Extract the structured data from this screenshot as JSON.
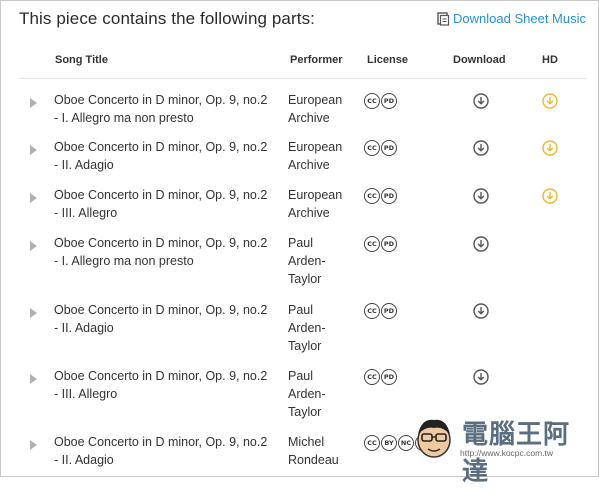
{
  "header": {
    "title": "This piece contains the following parts:",
    "download_sheet_label": "Download Sheet Music"
  },
  "table": {
    "columns": {
      "song_title": "Song Title",
      "performer": "Performer",
      "license": "License",
      "download": "Download",
      "hd": "HD"
    },
    "rows": [
      {
        "song_line1": "Oboe Concerto in D minor, Op. 9, no.2",
        "song_line2": "- I. Allegro ma non presto",
        "performer": [
          "European",
          "Archive"
        ],
        "license": [
          "CC",
          "PD"
        ],
        "has_download": true,
        "has_hd": true
      },
      {
        "song_line1": "Oboe Concerto in D minor, Op. 9, no.2",
        "song_line2": "- II. Adagio",
        "performer": [
          "European",
          "Archive"
        ],
        "license": [
          "CC",
          "PD"
        ],
        "has_download": true,
        "has_hd": true
      },
      {
        "song_line1": "Oboe Concerto in D minor, Op. 9, no.2",
        "song_line2": "- III. Allegro",
        "performer": [
          "European",
          "Archive"
        ],
        "license": [
          "CC",
          "PD"
        ],
        "has_download": true,
        "has_hd": true
      },
      {
        "song_line1": "Oboe Concerto in D minor, Op. 9, no.2",
        "song_line2": "- I. Allegro ma non presto",
        "performer": [
          "Paul",
          "Arden-",
          "Taylor"
        ],
        "license": [
          "CC",
          "PD"
        ],
        "has_download": true,
        "has_hd": false
      },
      {
        "song_line1": "Oboe Concerto in D minor, Op. 9, no.2",
        "song_line2": "- II. Adagio",
        "performer": [
          "Paul",
          "Arden-",
          "Taylor"
        ],
        "license": [
          "CC",
          "PD"
        ],
        "has_download": true,
        "has_hd": false
      },
      {
        "song_line1": "Oboe Concerto in D minor, Op. 9, no.2",
        "song_line2": "- III. Allegro",
        "performer": [
          "Paul",
          "Arden-",
          "Taylor"
        ],
        "license": [
          "CC",
          "PD"
        ],
        "has_download": true,
        "has_hd": false
      },
      {
        "song_line1": "Oboe Concerto in D minor, Op. 9, no.2",
        "song_line2": "- II. Adagio",
        "performer": [
          "Michel",
          "Rondeau"
        ],
        "license": [
          "CC",
          "BY",
          "NC",
          "ND"
        ],
        "has_download": false,
        "has_hd": false
      }
    ]
  },
  "watermark": {
    "text": "電腦王阿達",
    "url": "http://www.kocpc.com.tw"
  },
  "colors": {
    "link": "#2b8fd3",
    "hd_icon": "#e8b83a",
    "download_icon": "#555555",
    "play_icon": "#b0b0b0"
  },
  "icons": {
    "download_sheet": "document-icon",
    "download": "download-circle-icon",
    "hd": "hd-download-circle-icon",
    "play": "play-icon"
  }
}
